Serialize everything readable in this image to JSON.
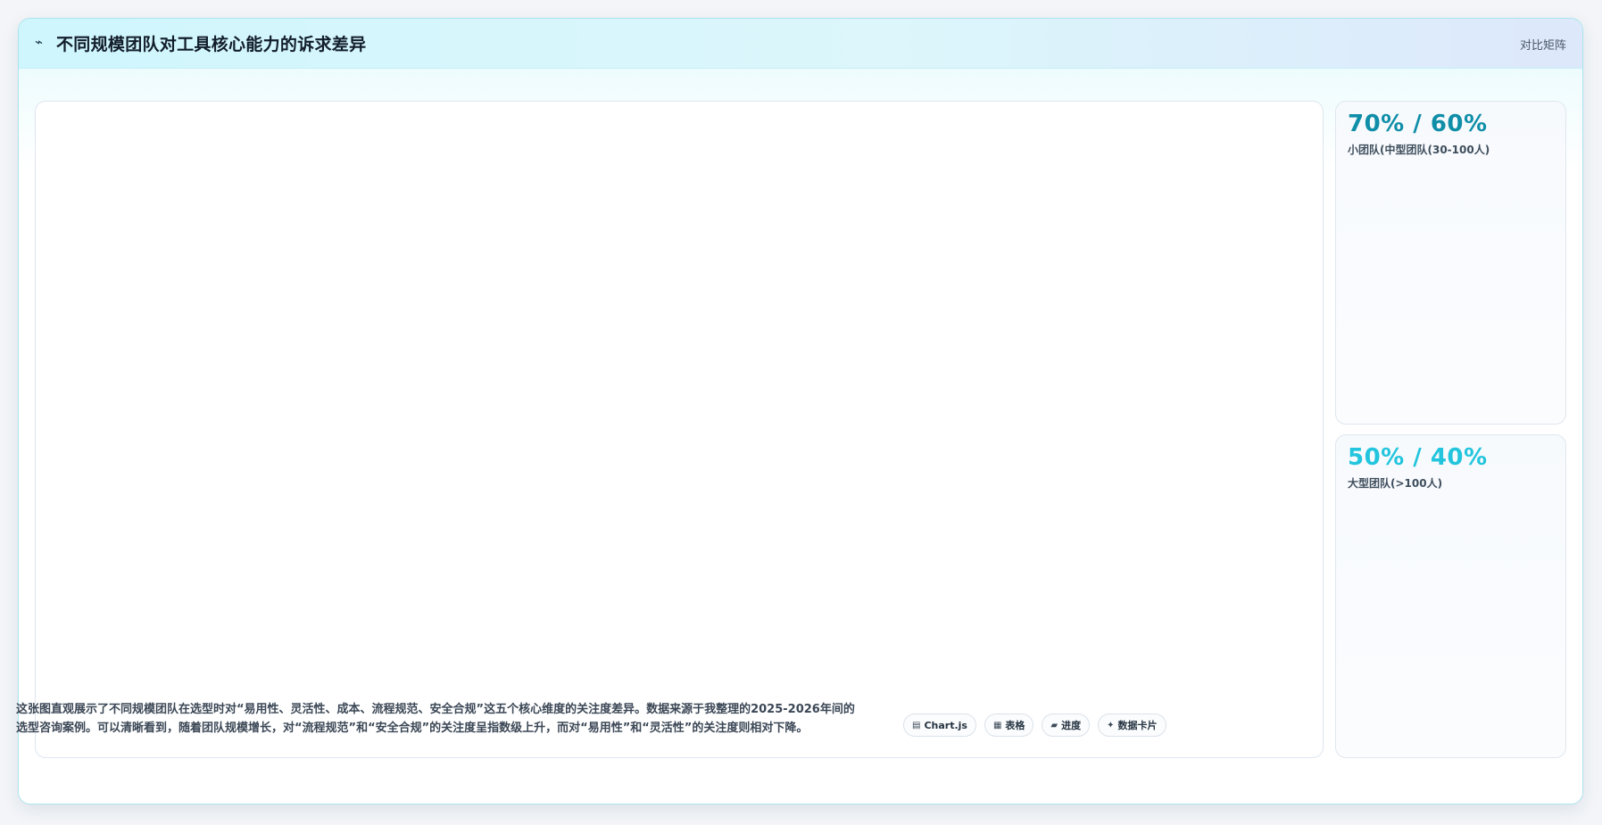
{
  "header": {
    "icon": "trend-line-icon",
    "title": "不同规模团队对工具核心能力的诉求差异",
    "tag": "对比矩阵"
  },
  "stats": [
    {
      "value": "70% / 60%",
      "label": "小团队(中型团队(30-100人)",
      "color": "#0f8ea8"
    },
    {
      "value": "50% / 40%",
      "label": "大型团队(>100人)",
      "color": "#22c5dd"
    }
  ],
  "description": "这张图直观展示了不同规模团队在选型时对“易用性、灵活性、成本、流程规范、安全合规”这五个核心维度的关注度差异。数据来源于我整理的2025-2026年间的选型咨询案例。可以清晰看到，随着团队规模增长，对“流程规范”和“安全合规”的关注度呈指数级上升，而对“易用性”和“灵活性”的关注度则相对下降。",
  "pills": [
    {
      "icon": "chart-icon",
      "glyph": "▤",
      "label": "Chart.js"
    },
    {
      "icon": "table-icon",
      "glyph": "▦",
      "label": "表格"
    },
    {
      "icon": "progress-icon",
      "glyph": "▰",
      "label": "进度"
    },
    {
      "icon": "sparkle-icon",
      "glyph": "✦",
      "label": "数据卡片"
    }
  ]
}
